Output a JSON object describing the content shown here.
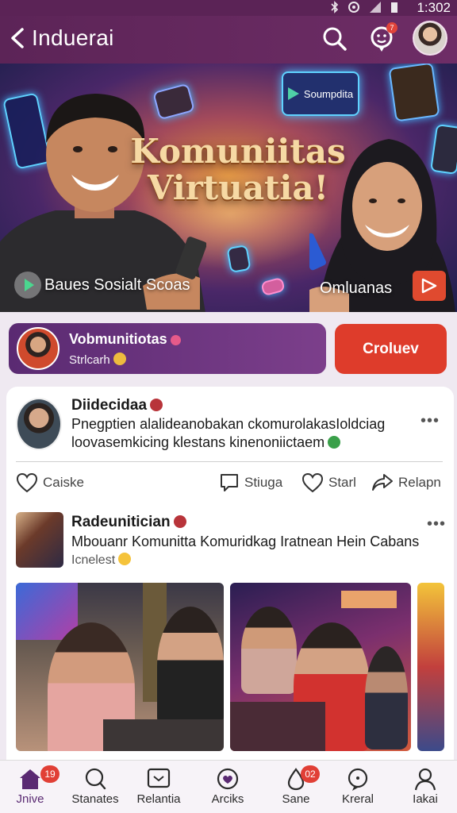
{
  "status_bar": {
    "time": "1:302"
  },
  "app_bar": {
    "title": "Induerai",
    "notification_count": "7"
  },
  "hero": {
    "headline_line1": "Komuniitas",
    "headline_line2": "Virtuatia!",
    "chip_label": "Soumpdita",
    "caption_left": "Baues Sosialt Scoas",
    "caption_right": "Omluanas"
  },
  "community": {
    "name": "Vobmunitiotas",
    "subtitle": "Strlcarh",
    "create_button": "Croluev"
  },
  "posts": [
    {
      "author": "Diidecidaa",
      "text_line1": "Pnegptien alalideanobakan ckomurolakasIoldciag",
      "text_line2": "loovasemkicing klestans kinenoniictaem"
    },
    {
      "author": "Radeunitician",
      "text_line1": "Mbouanr Komunitta Komuridkag Iratnean Hein Cabans",
      "text_line2": "Icnelest"
    }
  ],
  "actions": {
    "like": "Caiske",
    "comment": "Stiuga",
    "save": "Starl",
    "share": "Relapn"
  },
  "bottom_nav": {
    "items": [
      {
        "label": "Jnive",
        "icon": "home-icon",
        "badge": "19"
      },
      {
        "label": "Stanates",
        "icon": "search-icon",
        "badge": ""
      },
      {
        "label": "Relantia",
        "icon": "message-icon",
        "badge": ""
      },
      {
        "label": "Arciks",
        "icon": "heart-circle-icon",
        "badge": ""
      },
      {
        "label": "Sane",
        "icon": "drop-icon",
        "badge": "02"
      },
      {
        "label": "Kreral",
        "icon": "chat-bubble-icon",
        "badge": ""
      },
      {
        "label": "Iakai",
        "icon": "profile-icon",
        "badge": ""
      }
    ]
  },
  "colors": {
    "app_bar": "#5c2457",
    "accent_red": "#de3c2b",
    "community_purple": "#5a2a72"
  }
}
